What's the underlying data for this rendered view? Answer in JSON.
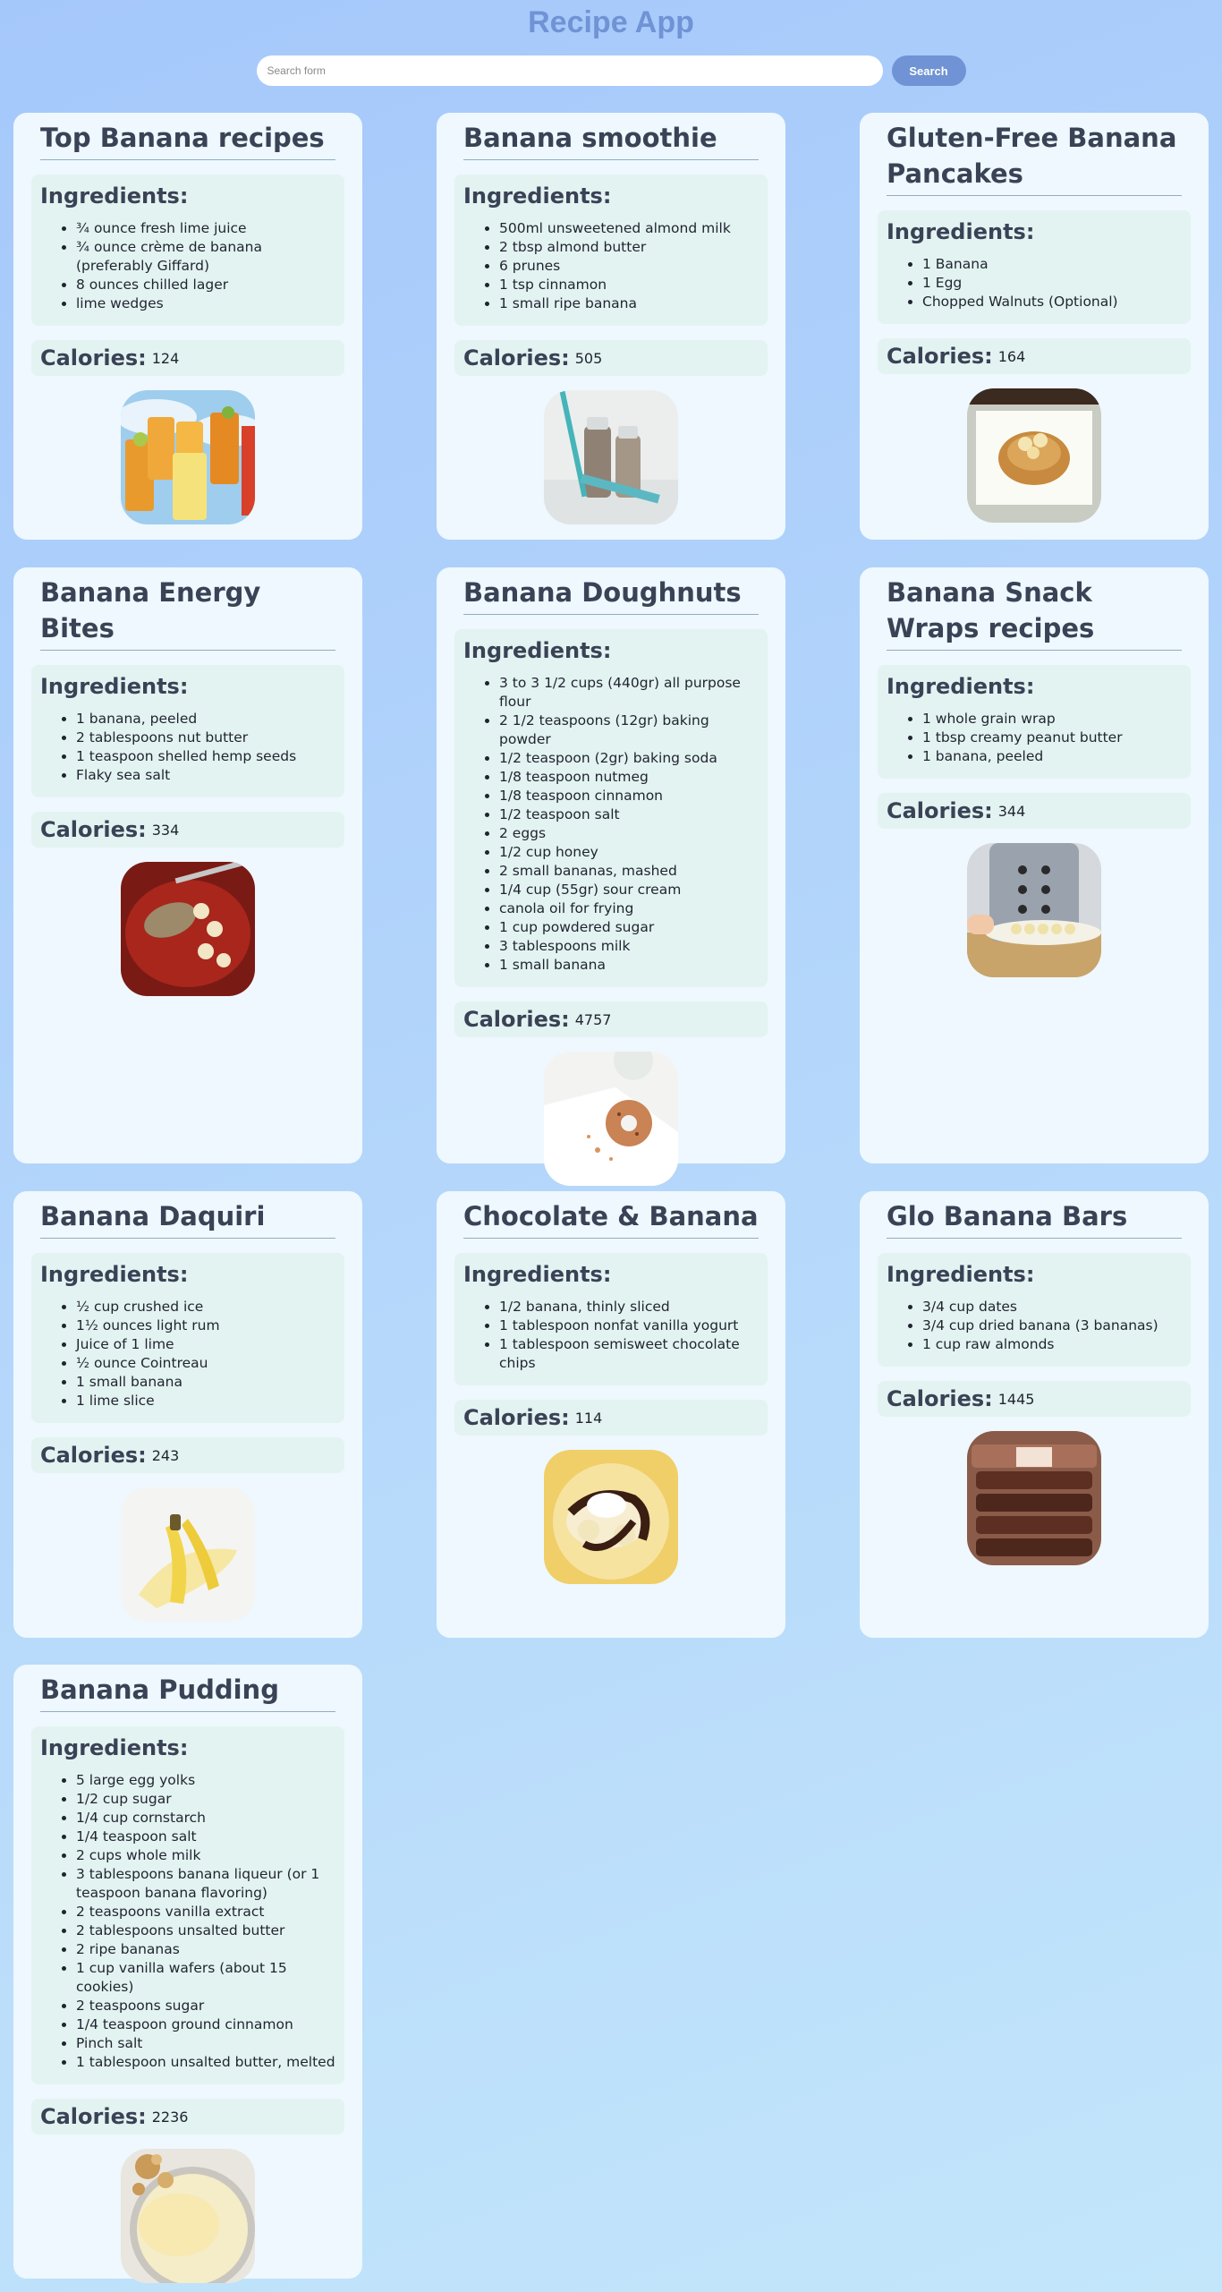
{
  "app": {
    "title": "Recipe App"
  },
  "search": {
    "placeholder": "Search form",
    "button_label": "Search"
  },
  "labels": {
    "ingredients": "Ingredients:",
    "calories": "Calories:"
  },
  "recipes": [
    {
      "title": "Top Banana recipes",
      "ingredients": [
        "¾ ounce fresh lime juice",
        "¾ ounce crème de banana (preferably Giffard)",
        "8 ounces chilled lager",
        "lime wedges"
      ],
      "calories": "124",
      "image": "iced-drinks-photo"
    },
    {
      "title": "Banana smoothie",
      "ingredients": [
        "500ml unsweetened almond milk",
        "2 tbsp almond butter",
        "6 prunes",
        "1 tsp cinnamon",
        "1 small ripe banana"
      ],
      "calories": "505",
      "image": "smoothie-bottles-photo"
    },
    {
      "title": "Gluten-Free Banana Pancakes",
      "ingredients": [
        "1 Banana",
        "1 Egg",
        "Chopped Walnuts (Optional)"
      ],
      "calories": "164",
      "image": "pancake-plate-photo"
    },
    {
      "title": "Banana Energy Bites",
      "ingredients": [
        "1 banana, peeled",
        "2 tablespoons nut butter",
        "1 teaspoon shelled hemp seeds",
        "Flaky sea salt"
      ],
      "calories": "334",
      "image": "energy-bites-photo"
    },
    {
      "title": "Banana Doughnuts",
      "ingredients": [
        "3 to 3 1/2 cups (440gr) all purpose flour",
        "2 1/2 teaspoons (12gr) baking powder",
        "1/2 teaspoon (2gr) baking soda",
        "1/8 teaspoon nutmeg",
        "1/8 teaspoon cinnamon",
        "1/2 teaspoon salt",
        "2 eggs",
        "1/2 cup honey",
        "2 small bananas, mashed",
        "1/4 cup (55gr) sour cream",
        "canola oil for frying",
        "1 cup powdered sugar",
        "3 tablespoons milk",
        "1 small banana"
      ],
      "calories": "4757",
      "image": "doughnut-photo"
    },
    {
      "title": "Banana Snack Wraps recipes",
      "ingredients": [
        "1 whole grain wrap",
        "1 tbsp creamy peanut butter",
        "1 banana, peeled"
      ],
      "calories": "344",
      "image": "chef-cartoon-illustration"
    },
    {
      "title": "Banana Daquiri",
      "ingredients": [
        "½ cup crushed ice",
        "1½ ounces light rum",
        "Juice of 1 lime",
        "½ ounce Cointreau",
        "1 small banana",
        "1 lime slice"
      ],
      "calories": "243",
      "image": "peeled-banana-photo"
    },
    {
      "title": "Chocolate & Banana",
      "ingredients": [
        "1/2 banana, thinly sliced",
        "1 tablespoon nonfat vanilla yogurt",
        "1 tablespoon semisweet chocolate chips"
      ],
      "calories": "114",
      "image": "chocolate-banana-photo"
    },
    {
      "title": "Glo Banana Bars",
      "ingredients": [
        "3/4 cup dates",
        "3/4 cup dried banana (3 bananas)",
        "1 cup raw almonds"
      ],
      "calories": "1445",
      "image": "banana-bars-photo"
    },
    {
      "title": "Banana Pudding",
      "ingredients": [
        "5 large egg yolks",
        "1/2 cup sugar",
        "1/4 cup cornstarch",
        "1/4 teaspoon salt",
        "2 cups whole milk",
        "3 tablespoons banana liqueur (or 1 teaspoon banana flavoring)",
        "2 teaspoons vanilla extract",
        "2 tablespoons unsalted butter",
        "2 ripe bananas",
        "1 cup vanilla wafers (about 15 cookies)",
        "2 teaspoons sugar",
        "1/4 teaspoon ground cinnamon",
        "Pinch salt",
        "1 tablespoon unsalted butter, melted"
      ],
      "calories": "2236",
      "image": "banana-pudding-photo"
    }
  ]
}
